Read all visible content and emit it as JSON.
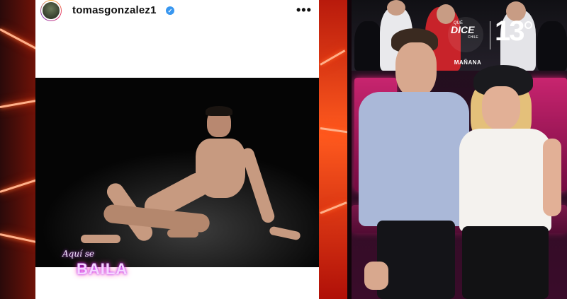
{
  "instagram_post": {
    "username": "tomasgonzalez1",
    "verified": true,
    "more_icon": "more-horizontal-icon",
    "more_glyph": "•••"
  },
  "show_overlay": {
    "script_text": "Aquí se",
    "main_text": "BAILA"
  },
  "tv_broadcast": {
    "show_logo": {
      "top_text": "QUÉ",
      "main_text": "DICE",
      "sub_text": "CHILE",
      "bottom_text": "MAÑANA"
    },
    "channel_number": "13"
  },
  "colors": {
    "neon_orange": "#ff5a1e",
    "verified_blue": "#3897f0",
    "logo_purple": "#b020ff",
    "studio_pink": "#ff2c8a"
  }
}
